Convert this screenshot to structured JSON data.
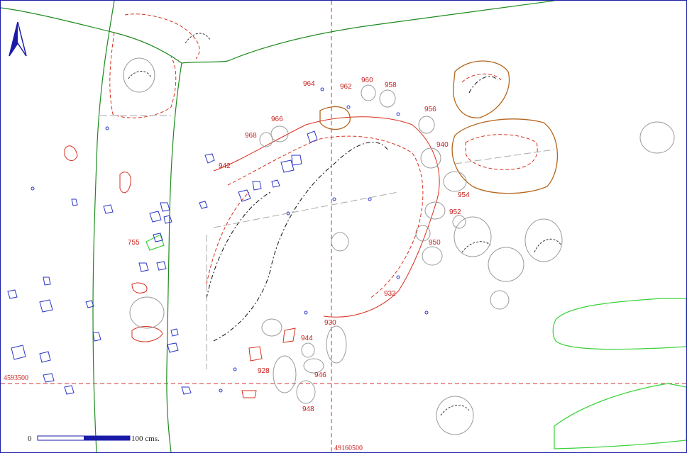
{
  "colors": {
    "blue_stone": "#2a35c8",
    "red_feature": "#d8301e",
    "grey_stone": "#9a9a9a",
    "green_boundary": "#1e8a1e",
    "light_green": "#3ad23a",
    "brown_pit": "#b5651d",
    "grid_red": "#d63030",
    "north_arrow": "#1a1aa8"
  },
  "north_arrow": {
    "icon": "north-arrow-icon"
  },
  "feature_labels": [
    {
      "text": "964"
    },
    {
      "text": "962"
    },
    {
      "text": "960"
    },
    {
      "text": "958"
    },
    {
      "text": "956"
    },
    {
      "text": "966"
    },
    {
      "text": "968"
    },
    {
      "text": "942"
    },
    {
      "text": "940"
    },
    {
      "text": "954"
    },
    {
      "text": "952"
    },
    {
      "text": "950"
    },
    {
      "text": "755"
    },
    {
      "text": "932"
    },
    {
      "text": "930"
    },
    {
      "text": "944"
    },
    {
      "text": "928"
    },
    {
      "text": "946"
    },
    {
      "text": "948"
    }
  ],
  "grid": {
    "northing_label": "4593500",
    "easting_label": "49160500"
  },
  "scale_bar": {
    "start_label": "0",
    "end_label": "100 cms."
  }
}
